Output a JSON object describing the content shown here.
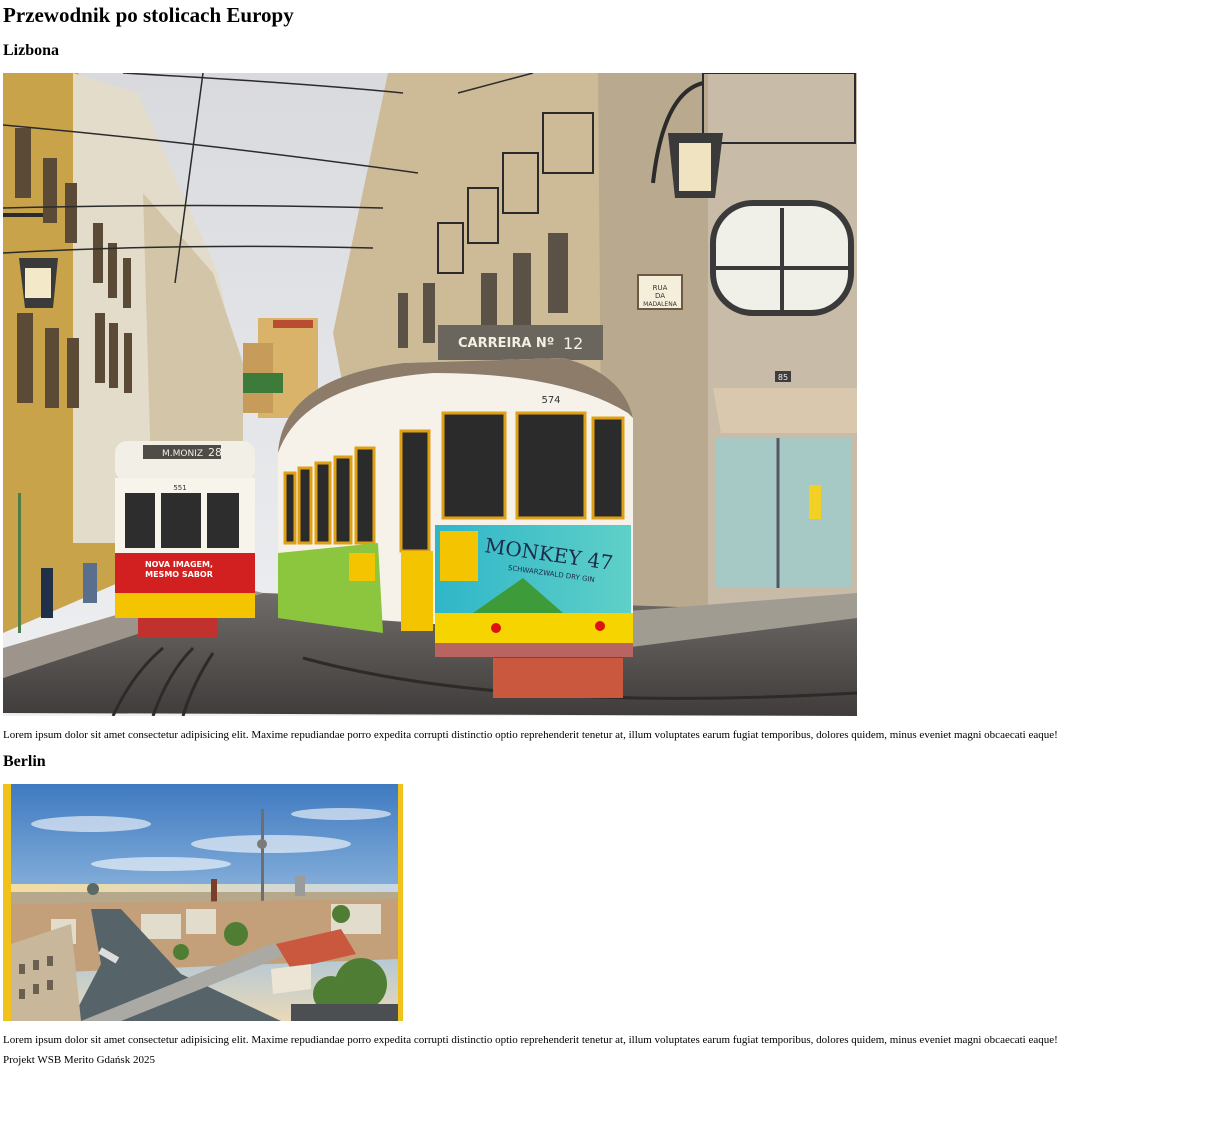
{
  "page": {
    "title": "Przewodnik po stolicach Europy"
  },
  "sections": [
    {
      "heading": "Lizbona",
      "image": {
        "alt": "Lizbona",
        "tram_route_sign_left": "M.MONIZ",
        "tram_route_number_left": "28",
        "tram_fleet_number_left": "551",
        "tram_ad_left": "NOVA IMAGEM, MESMO SABOR",
        "tram_route_sign_right": "CARREIRA Nº",
        "tram_route_number_right": "12",
        "tram_fleet_number_right": "574",
        "tram_ad_right": "MONKEY 47",
        "tram_ad_right_sub": "SCHWARZWALD DRY GIN",
        "street_sign": "RUA DA MADALENA",
        "house_number": "85"
      },
      "text": "Lorem ipsum dolor sit amet consectetur adipisicing elit. Maxime repudiandae porro expedita corrupti distinctio optio reprehenderit tenetur at, illum voluptates earum fugiat temporibus, dolores quidem, minus eveniet magni obcaecati eaque!"
    },
    {
      "heading": "Berlin",
      "image": {
        "alt": "Berlin",
        "frame_color": "#f2c21c"
      },
      "text": "Lorem ipsum dolor sit amet consectetur adipisicing elit. Maxime repudiandae porro expedita corrupti distinctio optio reprehenderit tenetur at, illum voluptates earum fugiat temporibus, dolores quidem, minus eveniet magni obcaecati eaque!"
    }
  ],
  "footer": {
    "text": "Projekt WSB Merito Gdańsk 2025"
  },
  "colors": {
    "tram_yellow": "#f5c400",
    "tram_red": "#d21f1f",
    "building_ochre": "#c9a34a",
    "sky_blue": "#4f86c6"
  }
}
